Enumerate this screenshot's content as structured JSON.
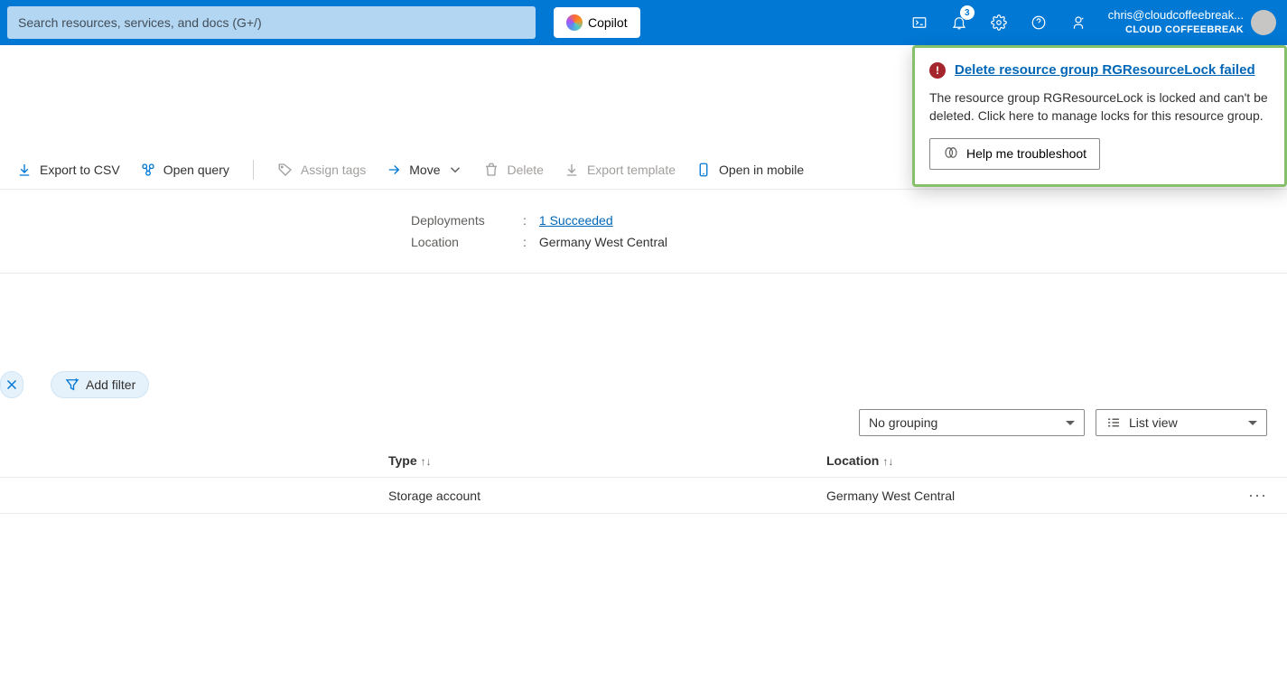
{
  "topbar": {
    "search_placeholder": "Search resources, services, and docs (G+/)",
    "copilot_label": "Copilot",
    "notification_count": "3",
    "account_email": "chris@cloudcoffeebreak...",
    "account_tenant": "CLOUD COFFEEBREAK"
  },
  "commands": {
    "export_csv": "Export to CSV",
    "open_query": "Open query",
    "assign_tags": "Assign tags",
    "move": "Move",
    "delete": "Delete",
    "export_template": "Export template",
    "open_mobile": "Open in mobile"
  },
  "details": {
    "deployments_label": "Deployments",
    "deployments_value": "1 Succeeded",
    "location_label": "Location",
    "location_value": "Germany West Central"
  },
  "filters": {
    "add_filter": "Add filter"
  },
  "view": {
    "grouping": "No grouping",
    "list_view": "List view"
  },
  "grid": {
    "col_type": "Type",
    "col_location": "Location",
    "rows": [
      {
        "type": "Storage account",
        "location": "Germany West Central"
      }
    ]
  },
  "notification": {
    "title": "Delete resource group RGResourceLock failed",
    "body": "The resource group RGResourceLock is locked and can't be deleted. Click here to manage locks for this resource group.",
    "button": "Help me troubleshoot"
  }
}
